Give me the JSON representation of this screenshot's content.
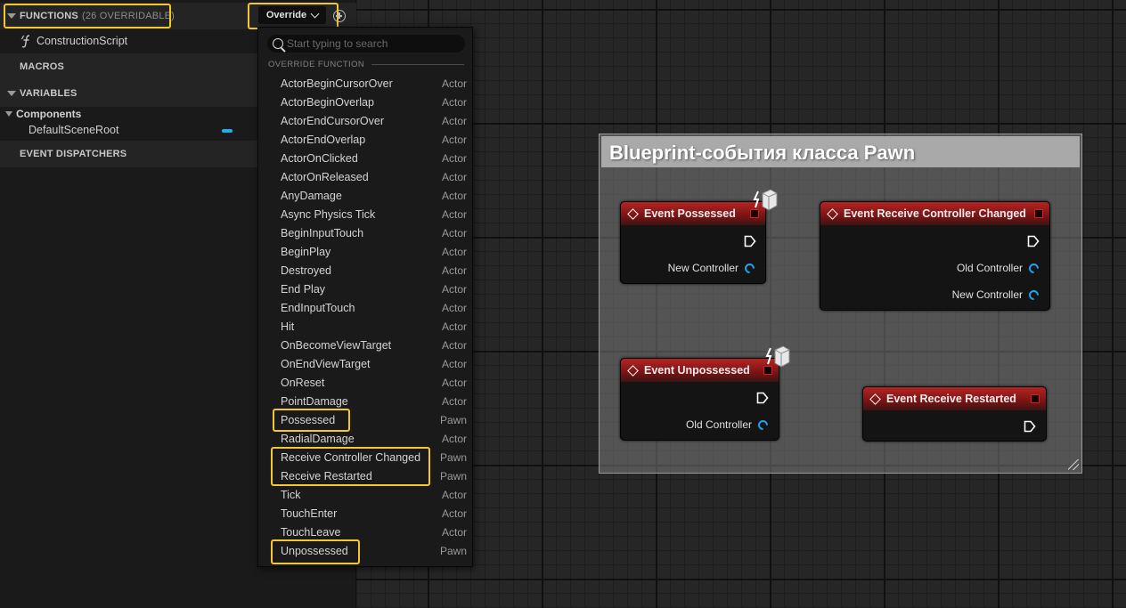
{
  "sidebar": {
    "functions": {
      "label": "FUNCTIONS",
      "count": "(26 OVERRIDABLE)"
    },
    "override_button": "Override",
    "construction_script": "ConstructionScript",
    "macros": "MACROS",
    "variables": "VARIABLES",
    "components": "Components",
    "default_scene_root": "DefaultSceneRoot",
    "event_dispatchers": "EVENT DISPATCHERS"
  },
  "dropdown": {
    "search_placeholder": "Start typing to search",
    "section_label": "OVERRIDE FUNCTION",
    "items": [
      {
        "name": "ActorBeginCursorOver",
        "cls": "Actor"
      },
      {
        "name": "ActorBeginOverlap",
        "cls": "Actor"
      },
      {
        "name": "ActorEndCursorOver",
        "cls": "Actor"
      },
      {
        "name": "ActorEndOverlap",
        "cls": "Actor"
      },
      {
        "name": "ActorOnClicked",
        "cls": "Actor"
      },
      {
        "name": "ActorOnReleased",
        "cls": "Actor"
      },
      {
        "name": "AnyDamage",
        "cls": "Actor"
      },
      {
        "name": "Async Physics Tick",
        "cls": "Actor"
      },
      {
        "name": "BeginInputTouch",
        "cls": "Actor"
      },
      {
        "name": "BeginPlay",
        "cls": "Actor"
      },
      {
        "name": "Destroyed",
        "cls": "Actor"
      },
      {
        "name": "End Play",
        "cls": "Actor"
      },
      {
        "name": "EndInputTouch",
        "cls": "Actor"
      },
      {
        "name": "Hit",
        "cls": "Actor"
      },
      {
        "name": "OnBecomeViewTarget",
        "cls": "Actor"
      },
      {
        "name": "OnEndViewTarget",
        "cls": "Actor"
      },
      {
        "name": "OnReset",
        "cls": "Actor"
      },
      {
        "name": "PointDamage",
        "cls": "Actor"
      },
      {
        "name": "Possessed",
        "cls": "Pawn"
      },
      {
        "name": "RadialDamage",
        "cls": "Actor"
      },
      {
        "name": "Receive Controller Changed",
        "cls": "Pawn"
      },
      {
        "name": "Receive Restarted",
        "cls": "Pawn"
      },
      {
        "name": "Tick",
        "cls": "Actor"
      },
      {
        "name": "TouchEnter",
        "cls": "Actor"
      },
      {
        "name": "TouchLeave",
        "cls": "Actor"
      },
      {
        "name": "Unpossessed",
        "cls": "Pawn"
      }
    ]
  },
  "comment": {
    "title": "Blueprint-события класса Pawn"
  },
  "nodes": {
    "possessed": {
      "title": "Event Possessed",
      "pin1": "New Controller"
    },
    "controller_changed": {
      "title": "Event Receive Controller Changed",
      "pin1": "Old Controller",
      "pin2": "New Controller"
    },
    "unpossessed": {
      "title": "Event Unpossessed",
      "pin1": "Old Controller"
    },
    "restarted": {
      "title": "Event Receive Restarted"
    }
  },
  "colors": {
    "highlight": "#f6c62f",
    "event_header": "#b52323",
    "object_pin": "#1aa6f0",
    "delegate_pin": "#d62020"
  },
  "icons": [
    "search-icon",
    "chevron-down-icon",
    "add-icon",
    "function-icon",
    "event-diamond-icon",
    "exec-pin-icon",
    "network-replication-icon",
    "resize-grip-icon"
  ]
}
